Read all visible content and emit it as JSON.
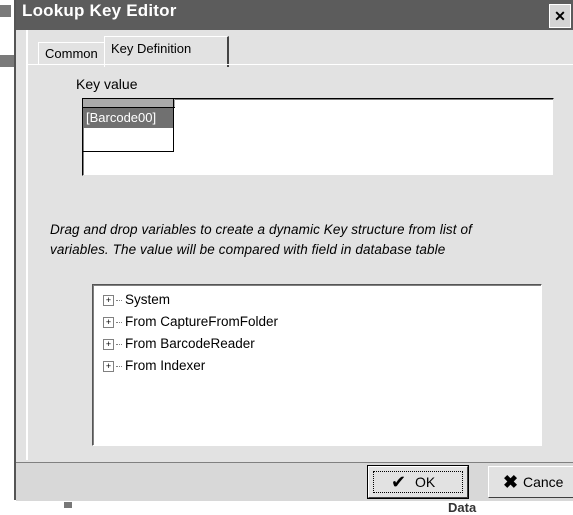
{
  "window": {
    "title": "Lookup Key Editor",
    "close_glyph": "✕"
  },
  "tabs": [
    {
      "label": "Common",
      "active": false
    },
    {
      "label": "Key Definition",
      "active": true
    }
  ],
  "key_value": {
    "label": "Key value",
    "items": [
      "[Barcode00]"
    ]
  },
  "hint_lines": [
    "Drag and drop variables to create a dynamic Key structure from list of",
    "variables. The value will be compared with field in database table"
  ],
  "variables_tree": [
    {
      "label": "System",
      "expander": "+"
    },
    {
      "label": "From CaptureFromFolder",
      "expander": "+"
    },
    {
      "label": "From BarcodeReader",
      "expander": "+"
    },
    {
      "label": "From Indexer",
      "expander": "+"
    }
  ],
  "footer": {
    "ok_label": "OK",
    "ok_icon": "check-icon",
    "cancel_label": "Cance",
    "cancel_icon": "x-icon"
  },
  "background_text": "Data"
}
